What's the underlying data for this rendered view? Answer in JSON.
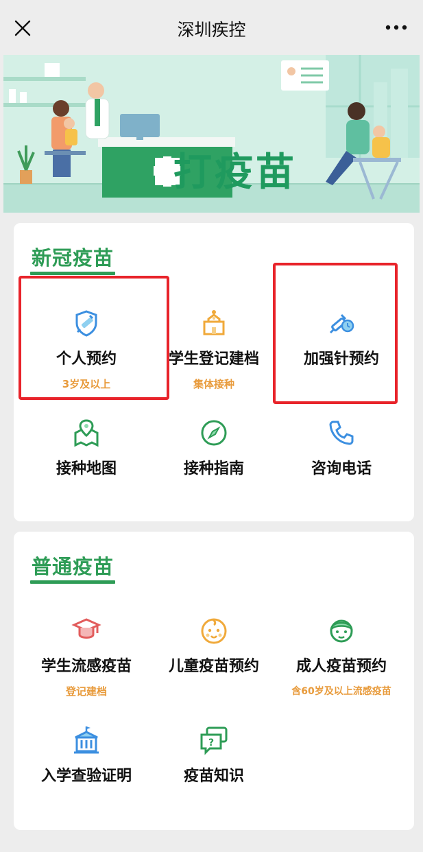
{
  "header": {
    "title": "深圳疾控"
  },
  "banner": {
    "title": "打疫苗"
  },
  "sections": [
    {
      "title": "新冠疫苗",
      "items": [
        {
          "label": "个人预约",
          "sub": "3岁及以上",
          "icon": "shield-syringe-icon"
        },
        {
          "label": "学生登记建档",
          "sub": "集体接种",
          "icon": "school-building-icon"
        },
        {
          "label": "加强针预约",
          "sub": "",
          "icon": "syringe-clock-icon"
        },
        {
          "label": "接种地图",
          "sub": "",
          "icon": "map-pin-icon"
        },
        {
          "label": "接种指南",
          "sub": "",
          "icon": "compass-icon"
        },
        {
          "label": "咨询电话",
          "sub": "",
          "icon": "phone-icon"
        }
      ]
    },
    {
      "title": "普通疫苗",
      "items": [
        {
          "label": "学生流感疫苗",
          "sub": "登记建档",
          "icon": "graduation-cap-icon"
        },
        {
          "label": "儿童疫苗预约",
          "sub": "",
          "icon": "baby-face-icon"
        },
        {
          "label": "成人疫苗预约",
          "sub": "含60岁及以上流感疫苗",
          "icon": "adult-face-icon"
        },
        {
          "label": "入学查验证明",
          "sub": "",
          "icon": "school-icon"
        },
        {
          "label": "疫苗知识",
          "sub": "",
          "icon": "question-chat-icon"
        }
      ]
    }
  ],
  "colors": {
    "accent_green": "#2e9c56",
    "sub_orange": "#e89b3c",
    "highlight_red": "#e8232a",
    "icon_blue": "#3c8fe0"
  }
}
